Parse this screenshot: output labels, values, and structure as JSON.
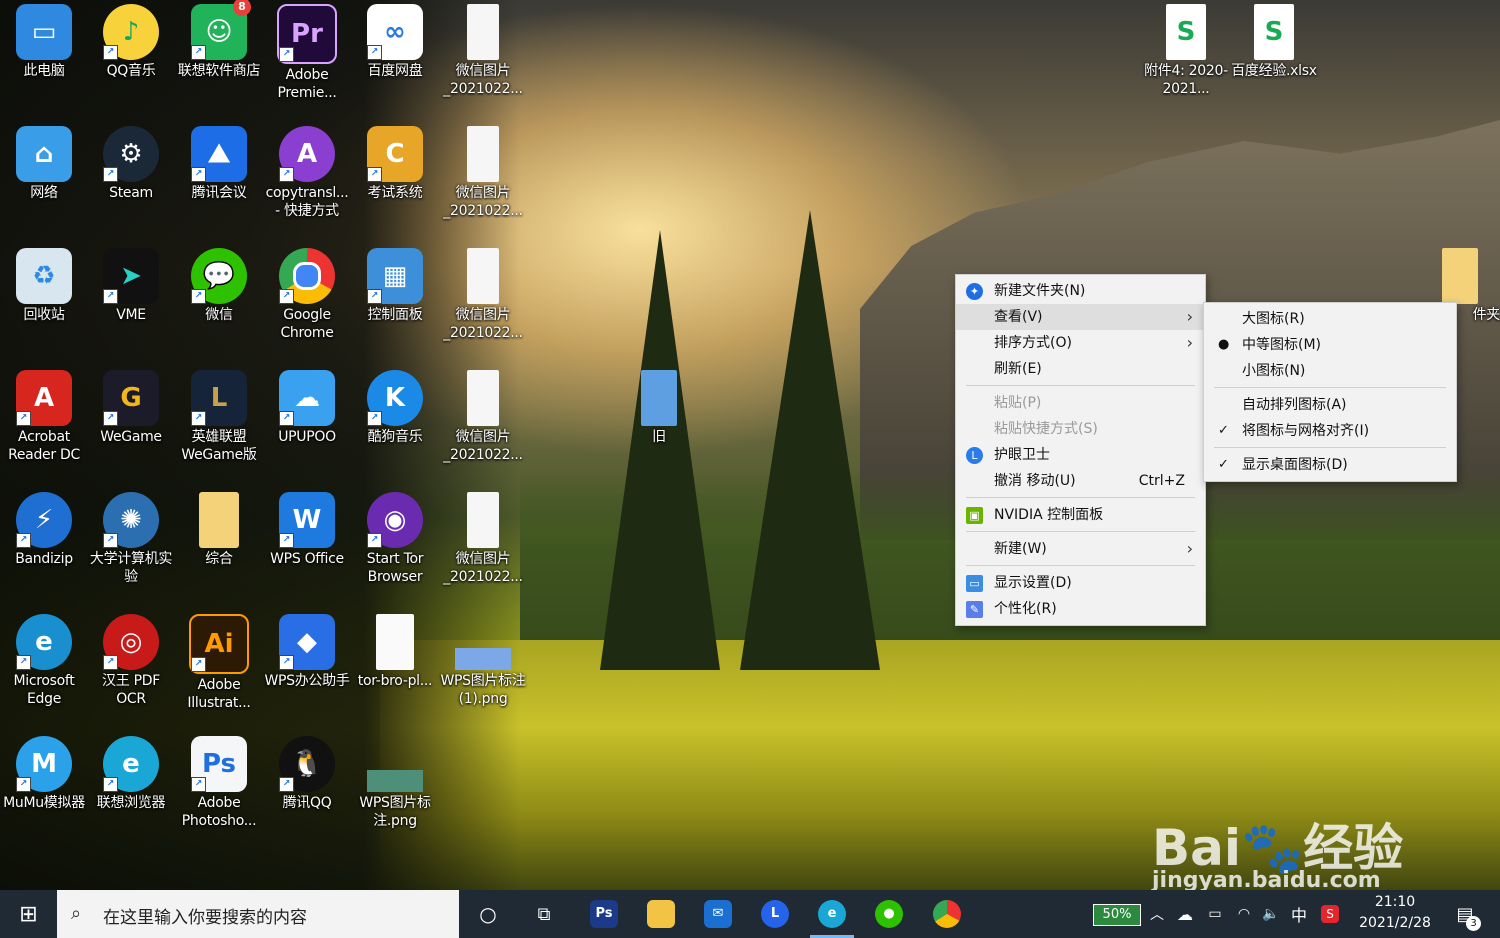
{
  "desktop_icons": {
    "this_pc": "此电脑",
    "qq_music": "QQ音乐",
    "lenovo_store": "联想软件商店",
    "lenovo_badge": "8",
    "premiere": "Adobe Premie...",
    "baidu_pan": "百度网盘",
    "wechat_img1": "微信图片_2021022...",
    "network": "网络",
    "steam": "Steam",
    "tencent_meeting": "腾讯会议",
    "copytrans": "copytransl... - 快捷方式",
    "exam_system": "考试系统",
    "wechat_img2": "微信图片_2021022...",
    "recycle_bin": "回收站",
    "vme": "VME",
    "wechat": "微信",
    "chrome": "Google Chrome",
    "control_panel": "控制面板",
    "wechat_img3": "微信图片_2021022...",
    "acrobat": "Acrobat Reader DC",
    "wegame": "WeGame",
    "lol": "英雄联盟WeGame版",
    "upupoo": "UPUPOO",
    "kugou": "酷狗音乐",
    "wechat_img4": "微信图片_2021022...",
    "bandizip": "Bandizip",
    "college_computer": "大学计算机实验",
    "zonghe": "综合",
    "wps_office": "WPS Office",
    "tor": "Start Tor Browser",
    "wechat_img5": "微信图片_2021022...",
    "edge": "Microsoft Edge",
    "hanwang": "汉王 PDF OCR",
    "illustrator": "Adobe Illustrat...",
    "wps_assistant": "WPS办公助手",
    "tor_file": "tor-bro-pl...",
    "wps_png1": "WPS图片标注(1).png",
    "mumu": "MuMu模拟器",
    "lenovo_browser": "联想浏览器",
    "photoshop": "Adobe Photosho...",
    "tencent_qq": "腾讯QQ",
    "wps_png2": "WPS图片标注.png",
    "attach4": "附件4: 2020-2021...",
    "baidu_xlsx": "百度经验.xlsx",
    "old_folder": "旧",
    "partial_folder": "件夹"
  },
  "context_menu": {
    "new_folder": "新建文件夹(N)",
    "view": "查看(V)",
    "sort": "排序方式(O)",
    "refresh": "刷新(E)",
    "paste": "粘贴(P)",
    "paste_shortcut": "粘贴快捷方式(S)",
    "guard": "护眼卫士",
    "undo": "撤消 移动(U)",
    "undo_shortcut": "Ctrl+Z",
    "nvidia": "NVIDIA 控制面板",
    "new": "新建(W)",
    "display": "显示设置(D)",
    "personalize": "个性化(R)"
  },
  "view_submenu": {
    "large": "大图标(R)",
    "medium": "中等图标(M)",
    "small": "小图标(N)",
    "auto_arrange": "自动排列图标(A)",
    "align_grid": "将图标与网格对齐(I)",
    "show_icons": "显示桌面图标(D)"
  },
  "taskbar": {
    "search_placeholder": "在这里输入你要搜索的内容",
    "battery": "50%",
    "ime": "中",
    "time": "21:10",
    "date": "2021/2/28",
    "notifications": "3"
  },
  "watermark": {
    "text1": "Bai",
    "text2": "经验",
    "url": "jingyan.baidu.com"
  },
  "colors": {
    "taskbar": "#1f2a35",
    "menu_bg": "#f2f2f2",
    "accent": "#1f6fe0"
  }
}
